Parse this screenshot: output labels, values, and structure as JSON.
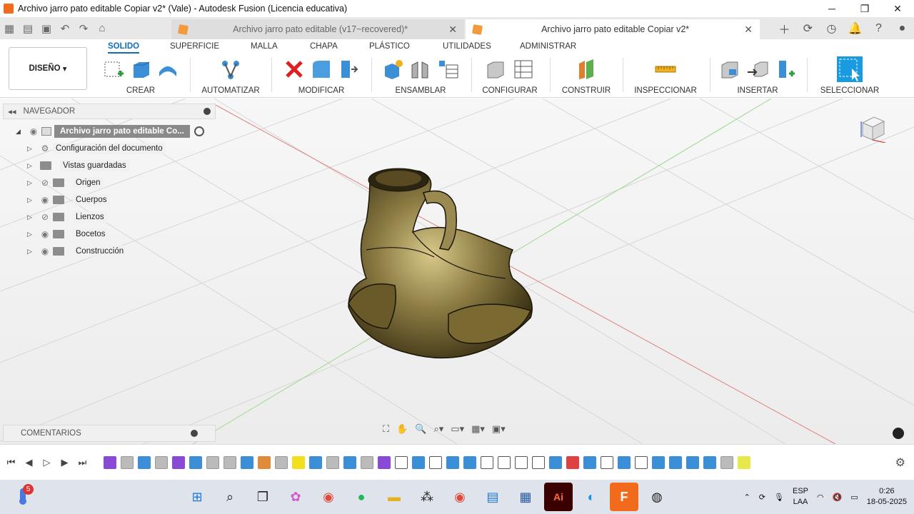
{
  "window": {
    "title": "Archivo jarro pato editable Copiar v2* (Vale) - Autodesk Fusion (Licencia educativa)"
  },
  "tabs": [
    {
      "label": "Archivo jarro pato editable (v17~recovered)*",
      "active": false
    },
    {
      "label": "Archivo jarro pato editable Copiar v2*",
      "active": true
    }
  ],
  "ribbon": {
    "workspace": "DISEÑO",
    "tabs": [
      "SOLIDO",
      "SUPERFICIE",
      "MALLA",
      "CHAPA",
      "PLÁSTICO",
      "UTILIDADES",
      "ADMINISTRAR"
    ],
    "groups": [
      "CREAR",
      "AUTOMATIZAR",
      "MODIFICAR",
      "ENSAMBLAR",
      "CONFIGURAR",
      "CONSTRUIR",
      "INSPECCIONAR",
      "INSERTAR",
      "SELECCIONAR"
    ]
  },
  "navigator": {
    "title": "NAVEGADOR",
    "root": "Archivo jarro pato editable Co...",
    "items": [
      {
        "label": "Configuración del documento"
      },
      {
        "label": "Vistas guardadas"
      },
      {
        "label": "Origen"
      },
      {
        "label": "Cuerpos"
      },
      {
        "label": "Lienzos"
      },
      {
        "label": "Bocetos"
      },
      {
        "label": "Construcción"
      }
    ]
  },
  "comments": {
    "title": "COMENTARIOS"
  },
  "taskbar": {
    "notification_count": "5",
    "language": "ESP",
    "region": "LAA",
    "time": "0:26",
    "date": "18-05-2025"
  },
  "colors": {
    "accent": "#0d6fb8",
    "model": "#7a6a3a"
  }
}
